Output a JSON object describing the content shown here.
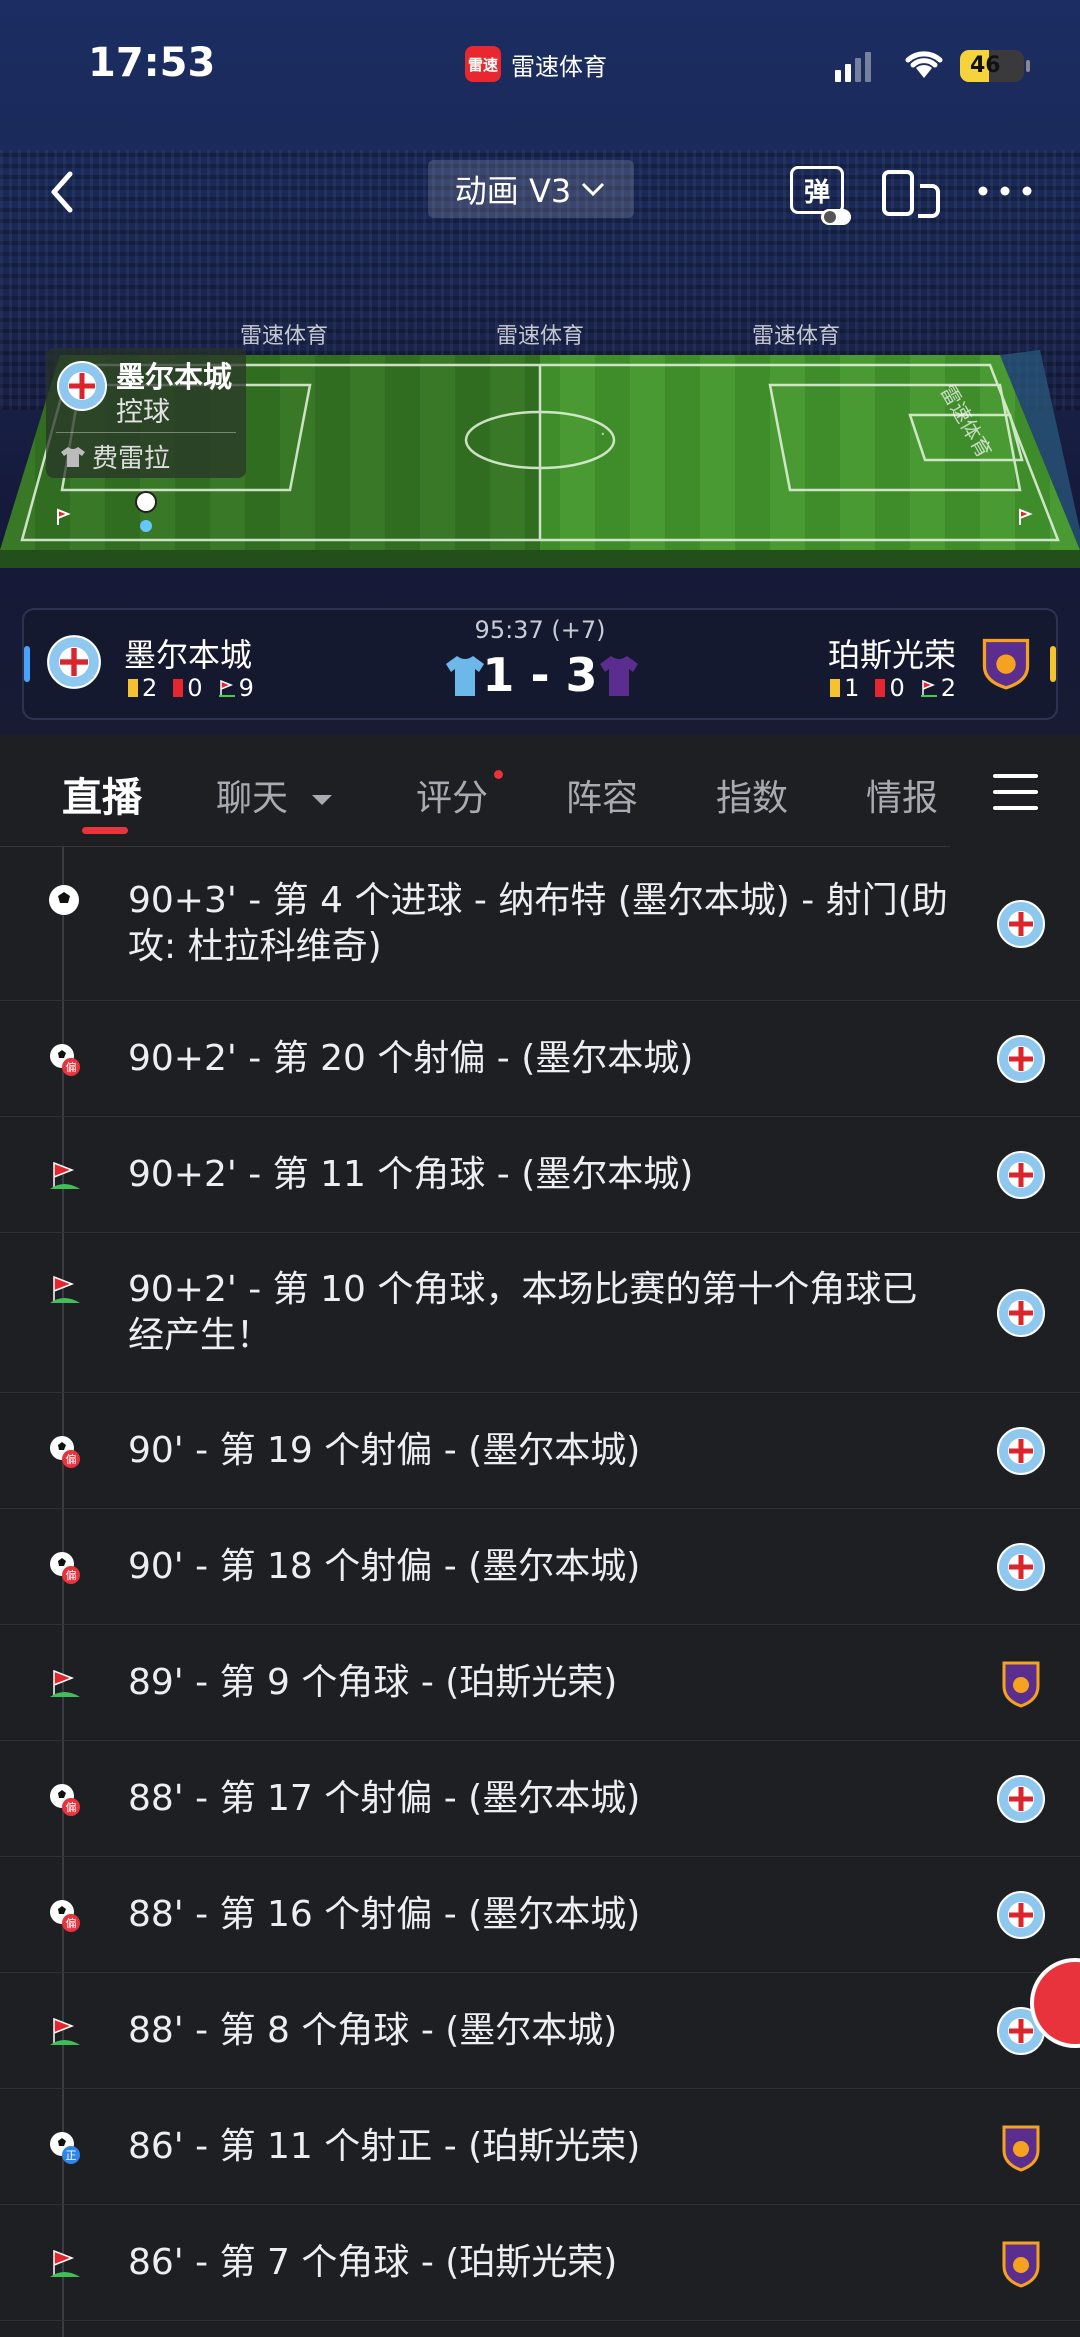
{
  "status_bar": {
    "time": "17:53",
    "app_name": "雷速体育",
    "app_icon_text": "雷速",
    "battery": "46"
  },
  "top_bar": {
    "view_mode": "动画 V3",
    "danmu_label": "弹"
  },
  "pitch": {
    "brand_labels": [
      "雷速体育",
      "雷速体育",
      "雷速体育"
    ],
    "side_brand": "雷速体育"
  },
  "possession": {
    "team": "墨尔本城",
    "status": "控球",
    "player": "费雷拉"
  },
  "scoreboard": {
    "match_time": "95:37 (+7)",
    "score": "1 - 3",
    "home": {
      "name": "墨尔本城",
      "yellow": "2",
      "red": "0",
      "corners": "9"
    },
    "away": {
      "name": "珀斯光荣",
      "yellow": "1",
      "red": "0",
      "corners": "2"
    }
  },
  "tabs": [
    "直播",
    "聊天",
    "评分",
    "阵容",
    "指数",
    "情报"
  ],
  "events": [
    {
      "type": "goal",
      "team": "home",
      "text": "90+3' - 第 4 个进球 - 纳布特 (墨尔本城) - 射门(助攻: 杜拉科维奇)"
    },
    {
      "type": "shot-off",
      "team": "home",
      "text": "90+2' - 第 20 个射偏 - (墨尔本城)"
    },
    {
      "type": "corner",
      "team": "home",
      "text": "90+2' - 第 11 个角球 - (墨尔本城)"
    },
    {
      "type": "corner",
      "team": "home",
      "text": "90+2' - 第 10 个角球，本场比赛的第十个角球已经产生！"
    },
    {
      "type": "shot-off",
      "team": "home",
      "text": "90' - 第 19 个射偏 - (墨尔本城)"
    },
    {
      "type": "shot-off",
      "team": "home",
      "text": "90' - 第 18 个射偏 - (墨尔本城)"
    },
    {
      "type": "corner",
      "team": "away",
      "text": "89' - 第 9 个角球 - (珀斯光荣)"
    },
    {
      "type": "shot-off",
      "team": "home",
      "text": "88' - 第 17 个射偏 - (墨尔本城)"
    },
    {
      "type": "shot-off",
      "team": "home",
      "text": "88' - 第 16 个射偏 - (墨尔本城)"
    },
    {
      "type": "corner",
      "team": "home",
      "text": "88' - 第 8 个角球 - (墨尔本城)"
    },
    {
      "type": "shot-on",
      "team": "away",
      "text": "86' - 第 11 个射正 - (珀斯光荣)"
    },
    {
      "type": "corner",
      "team": "away",
      "text": "86' - 第 7 个角球 - (珀斯光荣)"
    }
  ],
  "icon_glyphs": {
    "shot_off": "偏",
    "shot_on": "正"
  },
  "colors": {
    "accent": "#e8323c",
    "home_team": "#4aa3ff",
    "away_team": "#5b2d8e",
    "pitch": "#3f8f2c"
  }
}
